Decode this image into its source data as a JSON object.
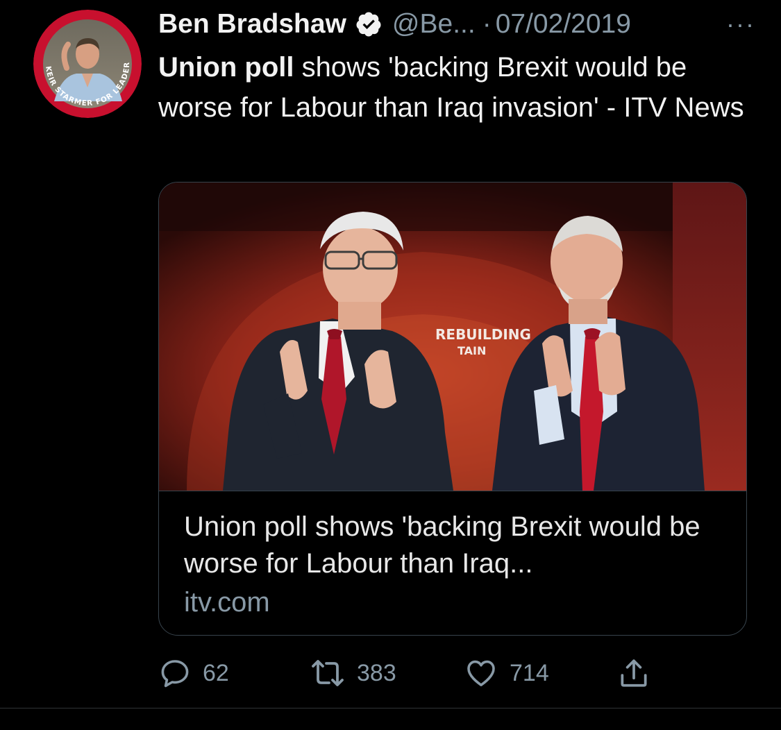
{
  "tweet": {
    "author_name": "Ben Bradshaw",
    "handle": "@Be...",
    "separator": "·",
    "date": "07/02/2019",
    "more_label": "···",
    "avatar_badge_text": "KEIR STARMER FOR LEADER",
    "text_bold": "Union poll",
    "text_rest": " shows 'backing Brexit would be worse for Labour than Iraq invasion' - ITV News"
  },
  "card": {
    "image_backdrop_text_line1": "REBUILDING",
    "image_backdrop_text_line2": "TAIN",
    "title": "Union poll shows 'backing Brexit would be worse for Labour than Iraq...",
    "domain": "itv.com"
  },
  "actions": {
    "replies": "62",
    "retweets": "383",
    "likes": "714"
  },
  "colors": {
    "background": "#000000",
    "text_primary": "#f2f2f2",
    "text_secondary": "#8899a6",
    "border": "#38444d",
    "avatar_ring": "#c8102e"
  },
  "icons": [
    "verified-badge-icon",
    "more-icon",
    "reply-icon",
    "retweet-icon",
    "like-icon",
    "share-icon"
  ]
}
